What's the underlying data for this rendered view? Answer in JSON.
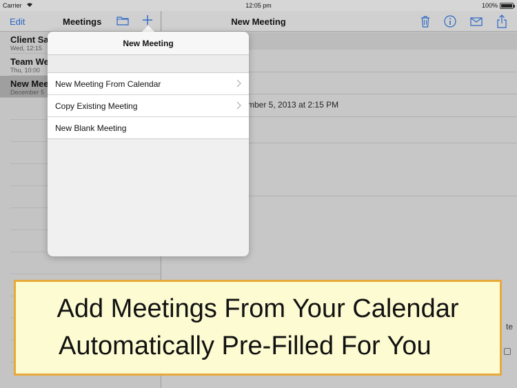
{
  "status_bar": {
    "carrier": "Carrier",
    "time": "12:05 pm",
    "battery": "100%"
  },
  "master": {
    "edit_label": "Edit",
    "title": "Meetings",
    "rows": [
      {
        "title": "Client Sa",
        "subtitle": "Wed, 12:15"
      },
      {
        "title": "Team We",
        "subtitle": "Thu, 10:00"
      },
      {
        "title": "New Mee",
        "subtitle": "December 5"
      }
    ]
  },
  "detail": {
    "title": "New Meeting",
    "date_text": "mber 5, 2013 at 2:15 PM",
    "partial_button": "te",
    "icons": [
      "trash-icon",
      "info-icon",
      "mail-icon",
      "share-icon"
    ]
  },
  "popover": {
    "title": "New Meeting",
    "items": [
      {
        "label": "New Meeting From Calendar",
        "chevron": true
      },
      {
        "label": "Copy Existing Meeting",
        "chevron": true
      },
      {
        "label": "New Blank Meeting",
        "chevron": false
      }
    ]
  },
  "banner": {
    "line1": "Add Meetings From Your Calendar",
    "line2": "Automatically Pre-Filled For You"
  },
  "colors": {
    "tint": "#2a67c4",
    "banner_fill": "#fdfbd1",
    "banner_border": "#e7a93b"
  }
}
